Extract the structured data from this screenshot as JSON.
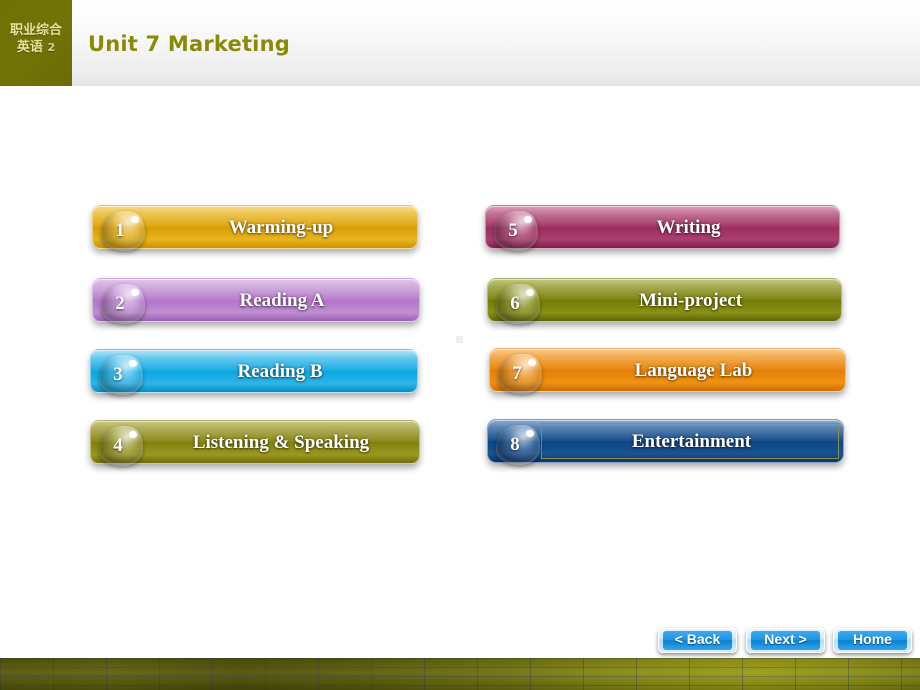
{
  "header": {
    "logo_line1": "职业综合",
    "logo_line2": "英语",
    "logo_number": "2",
    "title": "Unit 7 Marketing",
    "title_color": "#8a8a06",
    "logo_bg_color": "#70710 6"
  },
  "menu": {
    "left_column": [
      {
        "number": "1",
        "label": "Warming-up",
        "color": "#d99f05",
        "variant": "c-gold",
        "selected": false
      },
      {
        "number": "2",
        "label": "Reading A",
        "color": "#b375c9",
        "variant": "c-purple",
        "selected": false
      },
      {
        "number": "3",
        "label": "Reading B",
        "color": "#0aa7e2",
        "variant": "c-cyan",
        "selected": false
      },
      {
        "number": "4",
        "label": "Listening & Speaking",
        "color": "#84820f",
        "variant": "c-olive",
        "selected": false
      }
    ],
    "right_column": [
      {
        "number": "5",
        "label": "Writing",
        "color": "#9c2e5f",
        "variant": "c-maroon",
        "selected": false
      },
      {
        "number": "6",
        "label": "Mini-project",
        "color": "#767d05",
        "variant": "c-green",
        "selected": false
      },
      {
        "number": "7",
        "label": "Language Lab",
        "color": "#e57f05",
        "variant": "c-orange",
        "selected": false
      },
      {
        "number": "8",
        "label": "Entertainment",
        "color": "#0d4687",
        "variant": "c-navy",
        "selected": true
      }
    ]
  },
  "nav": {
    "back_label": "< Back",
    "next_label": "Next >",
    "home_label": "Home",
    "button_color": "#1c93e4"
  },
  "footer": {
    "bar_color": "#6e7010"
  }
}
